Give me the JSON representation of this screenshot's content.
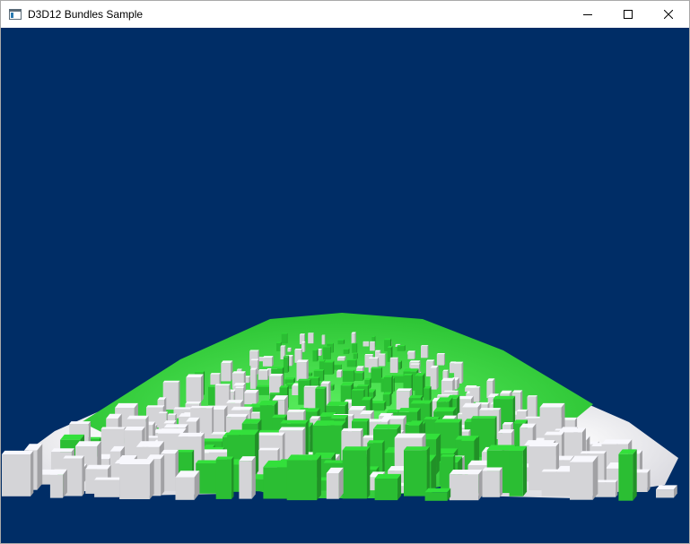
{
  "window": {
    "title": "D3D12 Bundles Sample",
    "controls": {
      "minimize_icon": "minimize-icon",
      "maximize_icon": "maximize-icon",
      "close_icon": "close-icon"
    }
  },
  "scene": {
    "background_color": "#002d66",
    "ground_color": "#f2f2f4",
    "green_building_color": "#2fcf37",
    "white_building_color": "#e6e6ea"
  }
}
